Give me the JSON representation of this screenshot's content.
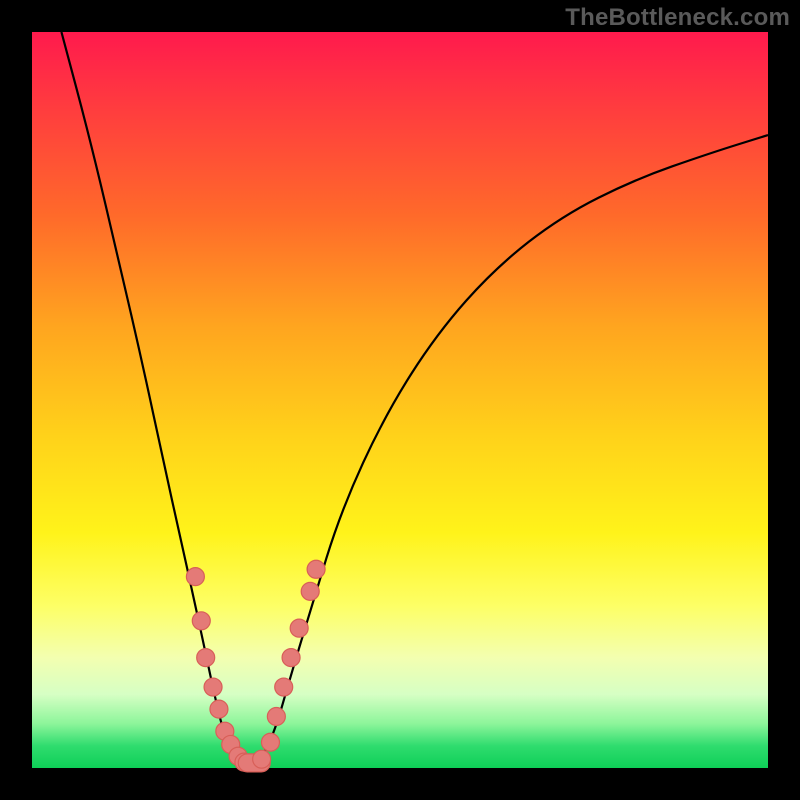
{
  "watermark": "TheBottleneck.com",
  "chart_data": {
    "type": "line",
    "title": "",
    "xlabel": "",
    "ylabel": "",
    "xlim": [
      0,
      100
    ],
    "ylim": [
      0,
      100
    ],
    "grid": false,
    "legend": false,
    "background": "rainbow-gradient red-top green-bottom",
    "series": [
      {
        "name": "left-arm",
        "x": [
          4,
          8,
          12,
          15,
          18,
          20,
          22,
          23.5,
          25,
          26,
          27,
          28
        ],
        "y": [
          100,
          85,
          68,
          55,
          41,
          32,
          23,
          16,
          9,
          5,
          2.5,
          1
        ]
      },
      {
        "name": "right-arm",
        "x": [
          31,
          33,
          35,
          38,
          42,
          48,
          55,
          63,
          72,
          82,
          92,
          100
        ],
        "y": [
          1,
          5,
          12,
          22,
          35,
          48,
          59,
          68,
          75,
          80,
          83.5,
          86
        ]
      },
      {
        "name": "bottom-join",
        "x": [
          28,
          29.5,
          31
        ],
        "y": [
          1,
          0.5,
          1
        ]
      }
    ],
    "marker_clusters": [
      {
        "name": "left-cluster",
        "points": [
          {
            "x": 22.2,
            "y": 26
          },
          {
            "x": 23.0,
            "y": 20
          },
          {
            "x": 23.6,
            "y": 15
          },
          {
            "x": 24.6,
            "y": 11
          },
          {
            "x": 25.4,
            "y": 8
          },
          {
            "x": 26.2,
            "y": 5
          },
          {
            "x": 27.0,
            "y": 3.2
          },
          {
            "x": 28.0,
            "y": 1.6
          }
        ]
      },
      {
        "name": "bottom-cluster",
        "points": [
          {
            "x": 28.8,
            "y": 0.8
          },
          {
            "x": 30.2,
            "y": 0.7
          },
          {
            "x": 31.2,
            "y": 1.2
          }
        ]
      },
      {
        "name": "right-cluster",
        "points": [
          {
            "x": 32.4,
            "y": 3.5
          },
          {
            "x": 33.2,
            "y": 7
          },
          {
            "x": 34.2,
            "y": 11
          },
          {
            "x": 35.2,
            "y": 15
          },
          {
            "x": 36.3,
            "y": 19
          },
          {
            "x": 37.8,
            "y": 24
          },
          {
            "x": 38.6,
            "y": 27
          }
        ]
      }
    ]
  }
}
